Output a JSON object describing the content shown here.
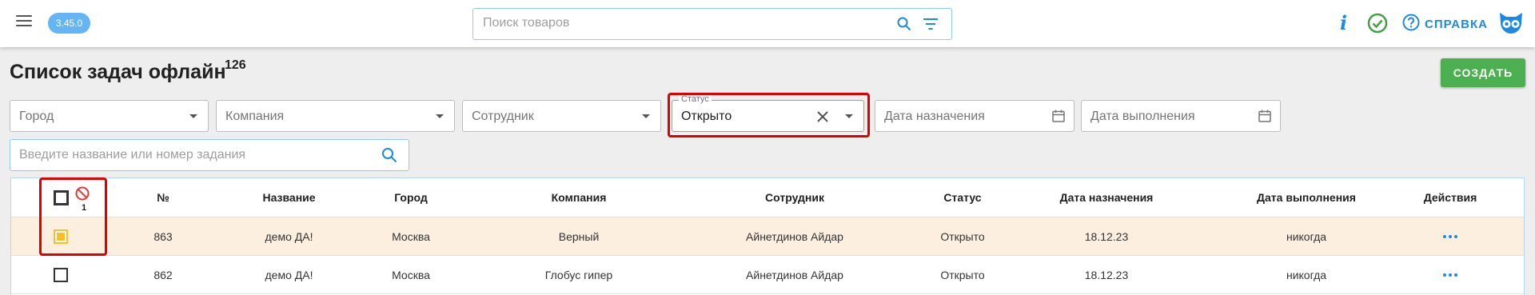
{
  "topbar": {
    "version": "3.45.0",
    "search_placeholder": "Поиск товаров",
    "help_label": "СПРАВКА",
    "icons": [
      "menu-icon",
      "search-icon",
      "filter-icon",
      "info-icon",
      "check-circle-icon",
      "help-circle-icon",
      "logo-icon"
    ],
    "colors": {
      "accent": "#1e88e5",
      "success": "#43a047"
    }
  },
  "header": {
    "title": "Список задач офлайн",
    "count": "126",
    "create_label": "СОЗДАТЬ"
  },
  "filters": {
    "city": "Город",
    "company": "Компания",
    "employee": "Сотрудник",
    "status_legend": "Статус",
    "status_value": "Открыто",
    "assign_date": "Дата назначения",
    "done_date": "Дата выполнения",
    "task_search_placeholder": "Введите название или номер задания"
  },
  "table": {
    "selected_count": "1",
    "columns": [
      "№",
      "Название",
      "Город",
      "Компания",
      "Сотрудник",
      "Статус",
      "Дата назначения",
      "Дата выполнения",
      "Действия"
    ],
    "rows": [
      {
        "selected": true,
        "num": "863",
        "name": "демо ДА!",
        "city": "Москва",
        "company": "Верный",
        "employee": "Айнетдинов Айдар",
        "status": "Открыто",
        "assigned": "18.12.23",
        "done": "никогда"
      },
      {
        "selected": false,
        "num": "862",
        "name": "демо ДА!",
        "city": "Москва",
        "company": "Глобус гипер",
        "employee": "Айнетдинов Айдар",
        "status": "Открыто",
        "assigned": "18.12.23",
        "done": "никогда"
      }
    ],
    "colors": {
      "selected_row": "#fdefe0",
      "checkbox_selected": "#fbbf24"
    }
  }
}
